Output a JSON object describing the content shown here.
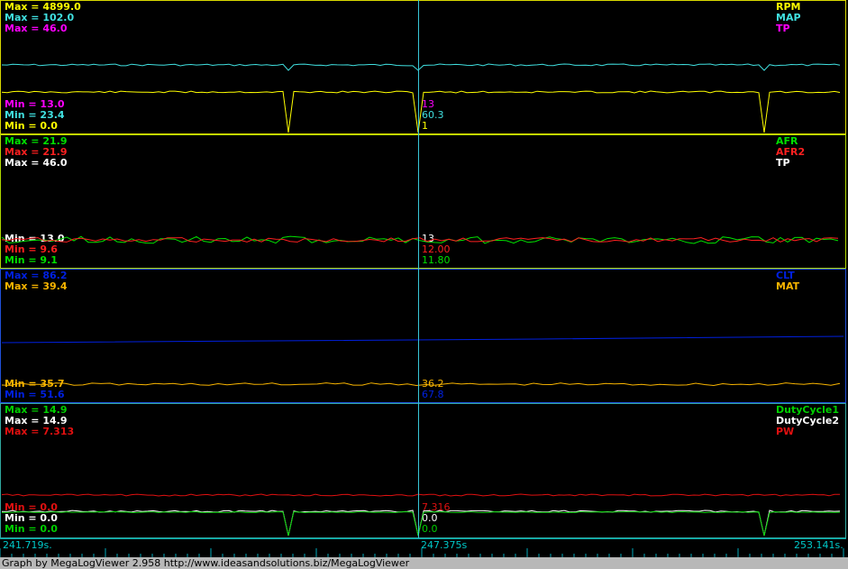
{
  "app": {
    "footer": "Graph by MegaLogViewer 2.958 http://www.ideasandsolutions.biz/MegaLogViewer"
  },
  "time_axis": {
    "start": "241.719s.",
    "cursor": "247.375s",
    "end": "253.141s."
  },
  "panels": [
    {
      "name": "panel-1",
      "border": "#d8d800",
      "max": [
        {
          "text": "Max = 4899.0",
          "color": "#ffff00"
        },
        {
          "text": "Max = 102.0",
          "color": "#40e0e0"
        },
        {
          "text": "Max = 46.0",
          "color": "#ff00ff"
        }
      ],
      "min": [
        {
          "text": "Min = 13.0",
          "color": "#ff00ff"
        },
        {
          "text": "Min = 23.4",
          "color": "#40e0e0"
        },
        {
          "text": "Min = 0.0",
          "color": "#ffff00"
        }
      ],
      "channels": [
        {
          "text": "RPM",
          "color": "#ffff00"
        },
        {
          "text": "MAP",
          "color": "#40e0e0"
        },
        {
          "text": "TP",
          "color": "#ff00ff"
        }
      ],
      "cursor": [
        {
          "text": "13",
          "color": "#ff00ff"
        },
        {
          "text": "60.3",
          "color": "#40e0e0"
        },
        {
          "text": "1",
          "color": "#ffff00"
        }
      ]
    },
    {
      "name": "panel-2",
      "border": "#b0d800",
      "max": [
        {
          "text": "Max = 21.9",
          "color": "#00e000"
        },
        {
          "text": "Max = 21.9",
          "color": "#ff2020"
        },
        {
          "text": "Max = 46.0",
          "color": "#ffffff"
        }
      ],
      "min": [
        {
          "text": "Min = 13.0",
          "color": "#ffffff"
        },
        {
          "text": "Min = 9.6",
          "color": "#ff2020"
        },
        {
          "text": "Min = 9.1",
          "color": "#00e000"
        }
      ],
      "channels": [
        {
          "text": "AFR",
          "color": "#00e000"
        },
        {
          "text": "AFR2",
          "color": "#ff2020"
        },
        {
          "text": "TP",
          "color": "#ffffff"
        }
      ],
      "cursor": [
        {
          "text": "13",
          "color": "#ffffff"
        },
        {
          "text": "12.00",
          "color": "#ff2020"
        },
        {
          "text": "11.80",
          "color": "#00e000"
        }
      ]
    },
    {
      "name": "panel-3",
      "border": "#2050d8",
      "max": [
        {
          "text": "Max = 86.2",
          "color": "#0020e0"
        },
        {
          "text": "Max = 39.4",
          "color": "#f8b400"
        }
      ],
      "min": [
        {
          "text": "Min = 35.7",
          "color": "#f8b400"
        },
        {
          "text": "Min = 51.6",
          "color": "#0020e0"
        }
      ],
      "channels": [
        {
          "text": "CLT",
          "color": "#0020e0"
        },
        {
          "text": "MAT",
          "color": "#f8b400"
        }
      ],
      "cursor": [
        {
          "text": "36.2",
          "color": "#f8b400"
        },
        {
          "text": "67.8",
          "color": "#0020e0"
        }
      ]
    },
    {
      "name": "panel-4",
      "border": "#30a8a0",
      "max": [
        {
          "text": "Max = 14.9",
          "color": "#00d000"
        },
        {
          "text": "Max = 14.9",
          "color": "#ffffff"
        },
        {
          "text": "Max = 7.313",
          "color": "#e01010"
        }
      ],
      "min": [
        {
          "text": "Min = 0.0",
          "color": "#e01010"
        },
        {
          "text": "Min = 0.0",
          "color": "#ffffff"
        },
        {
          "text": "Min = 0.0",
          "color": "#00d000"
        }
      ],
      "channels": [
        {
          "text": "DutyCycle1",
          "color": "#00d000"
        },
        {
          "text": "DutyCycle2",
          "color": "#ffffff"
        },
        {
          "text": "PW",
          "color": "#e01010"
        }
      ],
      "cursor": [
        {
          "text": "7.316",
          "color": "#e01010"
        },
        {
          "text": "0.0",
          "color": "#ffffff"
        },
        {
          "text": "0.0",
          "color": "#00d000"
        }
      ]
    }
  ]
}
